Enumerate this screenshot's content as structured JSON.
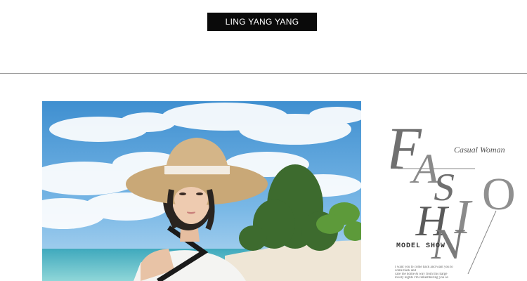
{
  "header": {
    "brand_label": "LING YANG YANG"
  },
  "hero": {
    "photo_icon": "woman-in-sun-hat-beach-photo"
  },
  "fashion_panel": {
    "letters": [
      "F",
      "A",
      "S",
      "H",
      "I",
      "O",
      "N"
    ],
    "casual_label": "Casual Woman",
    "model_label": "MODEL SHOW",
    "tagline_lines": [
      "I want you to come back and want you to",
      "come back and",
      "care me home & way from this barge",
      "lovely nights I'm remembering you so"
    ]
  },
  "colors": {
    "badge_bg": "#0a0a0a",
    "divider": "#9a9a9a",
    "sky": "#4a9ad6",
    "sea": "#5fc3c8",
    "sand": "#efe6d6",
    "hat": "#c9a877",
    "letters": "#666666"
  }
}
